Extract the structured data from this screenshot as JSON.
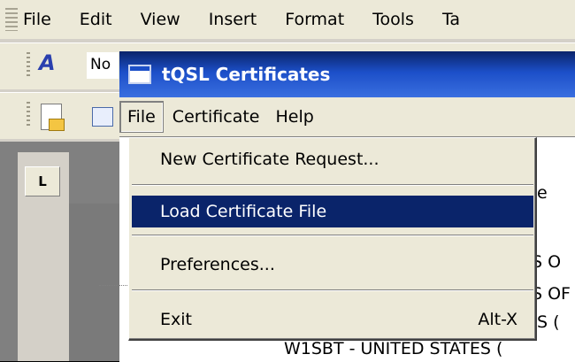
{
  "background_app": {
    "menu": [
      "File",
      "Edit",
      "View",
      "Insert",
      "Format",
      "Tools",
      "Ta"
    ],
    "style_box_text": "No",
    "ruler_corner": "L"
  },
  "dialog": {
    "title": "tQSL Certificates",
    "menu": [
      "File",
      "Certificate",
      "Help"
    ],
    "tree_fragments": [
      "e",
      "S O",
      "S OF",
      "ES (",
      "W1SBT - UNITED STATES ("
    ]
  },
  "file_menu": {
    "items": {
      "new_request": "New Certificate Request...",
      "load_file": "Load Certificate File",
      "preferences": "Preferences...",
      "exit": "Exit",
      "exit_shortcut": "Alt-X"
    },
    "highlighted": "Load Certificate File"
  },
  "colors": {
    "highlight": "#0a246a",
    "titlebar": "#1c4fc8",
    "menu_bg": "#ece9d8"
  }
}
